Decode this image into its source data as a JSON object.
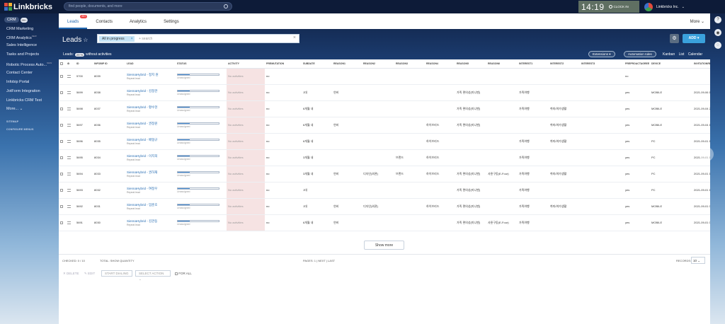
{
  "topbar": {
    "logo": "Linkbricks",
    "search_placeholder": "find people, documents, and more",
    "clock": "14:19",
    "clock_in": "CLOCK IN",
    "user": "Linkbricks Inc."
  },
  "sidebar": {
    "crm_label": "CRM",
    "crm_count": "99+",
    "items": [
      {
        "label": "CRM Marketing",
        "sup": ""
      },
      {
        "label": "CRM Analytics",
        "sup": "NEW"
      },
      {
        "label": "Sales Intelligence",
        "sup": ""
      },
      {
        "label": "Tasks and Projects",
        "sup": ""
      },
      {
        "label": "Robotic Process Auto...",
        "sup": "NEW"
      },
      {
        "label": "Contact Center",
        "sup": ""
      },
      {
        "label": "Infobip Portal",
        "sup": ""
      },
      {
        "label": "JotForm Integration",
        "sup": ""
      },
      {
        "label": "Linkbricks CRM Test",
        "sup": ""
      },
      {
        "label": "More... ⌄",
        "sup": ""
      }
    ],
    "sitemap": "SITEMAP",
    "configure": "CONFIGURE MENUS"
  },
  "tabs": [
    {
      "label": "Leads",
      "badge": "99+",
      "active": true
    },
    {
      "label": "Contacts",
      "badge": "",
      "active": false
    },
    {
      "label": "Analytics",
      "badge": "",
      "active": false
    },
    {
      "label": "Settings",
      "badge": "",
      "active": false
    }
  ],
  "more_label": "More ⌄",
  "header": {
    "title": "Leads",
    "filter_chip": "All in progress",
    "filter_placeholder": "+ search",
    "add_label": "ADD",
    "leads_prefix": "Leads:",
    "leads_count": "29 %",
    "leads_suffix": "without activities",
    "extensions": "Extensions",
    "automation": "Automation rules",
    "views": [
      "Kanban",
      "List",
      "Calendar"
    ]
  },
  "columns": [
    "ID",
    "INFOBIP ID",
    "LEAD",
    "STATUS",
    "ACTIVITY",
    "PREMUTATION",
    "SUBDATE",
    "REASON1",
    "REASON2",
    "REASON3",
    "REASON4",
    "REASON5",
    "REASON6",
    "INTEREST1",
    "INTEREST2",
    "INTEREST3",
    "PREPROACTAGREE",
    "DEVICE",
    "INVITATIONRECEI"
  ],
  "rows": [
    {
      "id": "5700",
      "infobip": "8039",
      "lead": "SiennaHybrid - 정지 원",
      "lead_sub": "Repeat lead",
      "progress": 0.3,
      "status": "Unassigned",
      "activity": "No activities",
      "perm": "no",
      "subdate": "",
      "r1": "",
      "r2": "",
      "r3": "",
      "r4": "",
      "r5": "",
      "r6": "",
      "i1": "",
      "i2": "",
      "i3": "",
      "agree": "no",
      "device": "",
      "inv": ""
    },
    {
      "id": "5699",
      "infobip": "8038",
      "lead": "SiennaHybrid - 김정관",
      "lead_sub": "Repeat lead",
      "progress": 0.3,
      "status": "Unassigned",
      "activity": "No activities",
      "perm": "no",
      "subdate": "1대",
      "r1": "연비",
      "r2": "",
      "r3": "",
      "r4": "",
      "r5": "가족 편의성(미니밴)",
      "r6": "",
      "i1": "가족여행",
      "i2": "",
      "i3": "",
      "agree": "yes",
      "device": "MOBILE",
      "inv": "2021-09-06 17:36"
    },
    {
      "id": "5698",
      "infobip": "8037",
      "lead": "SiennaHybrid - 황수현",
      "lead_sub": "Repeat lead",
      "progress": 0.3,
      "status": "Unassigned",
      "activity": "No activities",
      "perm": "no",
      "subdate": "6개월 내",
      "r1": "",
      "r2": "",
      "r3": "",
      "r4": "",
      "r5": "가족 편의성(미니밴)",
      "r6": "",
      "i1": "가족여행",
      "i2": "취미/여가생활",
      "i3": "",
      "agree": "yes",
      "device": "MOBILE",
      "inv": "2021-09-04 22:38"
    },
    {
      "id": "5697",
      "infobip": "8036",
      "lead": "SiennaHybrid - 권정원",
      "lead_sub": "Repeat lead",
      "progress": 0.3,
      "status": "Unassigned",
      "activity": "No activities",
      "perm": "no",
      "subdate": "6개월 내",
      "r1": "연비",
      "r2": "",
      "r3": "",
      "r4": "하이브리드",
      "r5": "가족 편의성(미니밴)",
      "r6": "",
      "i1": "",
      "i2": "취미/여가생활",
      "i3": "",
      "agree": "yes",
      "device": "MOBILE",
      "inv": "2021-09-04 11:16"
    },
    {
      "id": "5696",
      "infobip": "8035",
      "lead": "SiennaHybrid - 배형규",
      "lead_sub": "Repeat lead",
      "progress": 0.3,
      "status": "Unassigned",
      "activity": "No activities",
      "perm": "no",
      "subdate": "6개월 내",
      "r1": "",
      "r2": "",
      "r3": "",
      "r4": "하이브리드",
      "r5": "",
      "r6": "",
      "i1": "가족여행",
      "i2": "취미/여가생활",
      "i3": "",
      "agree": "yes",
      "device": "PC",
      "inv": "2021-09-01 19:07"
    },
    {
      "id": "5695",
      "infobip": "8034",
      "lead": "SiennaHybrid - 이지희",
      "lead_sub": "Repeat lead",
      "progress": 0.3,
      "status": "Unassigned",
      "activity": "No activities",
      "perm": "no",
      "subdate": "3개월 내",
      "r1": "",
      "r2": "",
      "r3": "브랜드",
      "r4": "하이브리드",
      "r5": "",
      "r6": "",
      "i1": "가족여행",
      "i2": "",
      "i3": "",
      "agree": "yes",
      "device": "PC",
      "inv": "2021-09-01 14:51"
    },
    {
      "id": "5694",
      "infobip": "8033",
      "lead": "SiennaHybrid - 권하재",
      "lead_sub": "Repeat lead",
      "progress": 0.3,
      "status": "Unassigned",
      "activity": "No activities",
      "perm": "no",
      "subdate": "3개월 내",
      "r1": "연비",
      "r2": "디자인(외관)",
      "r3": "브랜드",
      "r4": "하이브리드",
      "r5": "가족 편의성(미니밴)",
      "r6": "사륜구동(E-Four)",
      "i1": "가족여행",
      "i2": "취미/여가생활",
      "i3": "",
      "agree": "yes",
      "device": "PC",
      "inv": "2021-09-01 13:23"
    },
    {
      "id": "5693",
      "infobip": "8032",
      "lead": "SiennaHybrid - 여정우",
      "lead_sub": "Repeat lead",
      "progress": 0.3,
      "status": "Unassigned",
      "activity": "No activities",
      "perm": "no",
      "subdate": "1대",
      "r1": "",
      "r2": "",
      "r3": "",
      "r4": "",
      "r5": "가족 편의성(미니밴)",
      "r6": "",
      "i1": "가족여행",
      "i2": "",
      "i3": "",
      "agree": "yes",
      "device": "PC",
      "inv": "2021-09-01 10:29"
    },
    {
      "id": "5692",
      "infobip": "8031",
      "lead": "SiennaHybrid - 엄준호",
      "lead_sub": "Repeat lead",
      "progress": 0.3,
      "status": "Unassigned",
      "activity": "No activities",
      "perm": "no",
      "subdate": "1대",
      "r1": "연비",
      "r2": "디자인(외관)",
      "r3": "",
      "r4": "하이브리드",
      "r5": "가족 편의성(미니밴)",
      "r6": "",
      "i1": "가족여행",
      "i2": "취미/여가생활",
      "i3": "",
      "agree": "yes",
      "device": "MOBILE",
      "inv": "2021-09-01 09:30"
    },
    {
      "id": "5691",
      "infobip": "8030",
      "lead": "SiennaHybrid - 김관동",
      "lead_sub": "Repeat lead",
      "progress": 0.3,
      "status": "Unassigned",
      "activity": "No activities",
      "perm": "no",
      "subdate": "6개월 내",
      "r1": "연비",
      "r2": "",
      "r3": "",
      "r4": "",
      "r5": "가족 편의성(미니밴)",
      "r6": "사륜구동(E-Four)",
      "i1": "가족여행",
      "i2": "",
      "i3": "",
      "agree": "yes",
      "device": "MOBILE",
      "inv": "2021-09-01 09:25"
    }
  ],
  "show_more": "Show more",
  "footer": {
    "checked": "CHECKED: 0 / 10",
    "total": "TOTAL: SHOW QUANTITY",
    "pages": "PAGES: 1  |  NEXT  |  LAST",
    "records_label": "RECORDS:",
    "records_value": "10"
  },
  "actions": {
    "delete": "✕ DELETE",
    "edit": "✎ EDIT",
    "start_dialing": "START DIALING",
    "select_action": "SELECT ACTION",
    "for_all": "FOR ALL"
  }
}
